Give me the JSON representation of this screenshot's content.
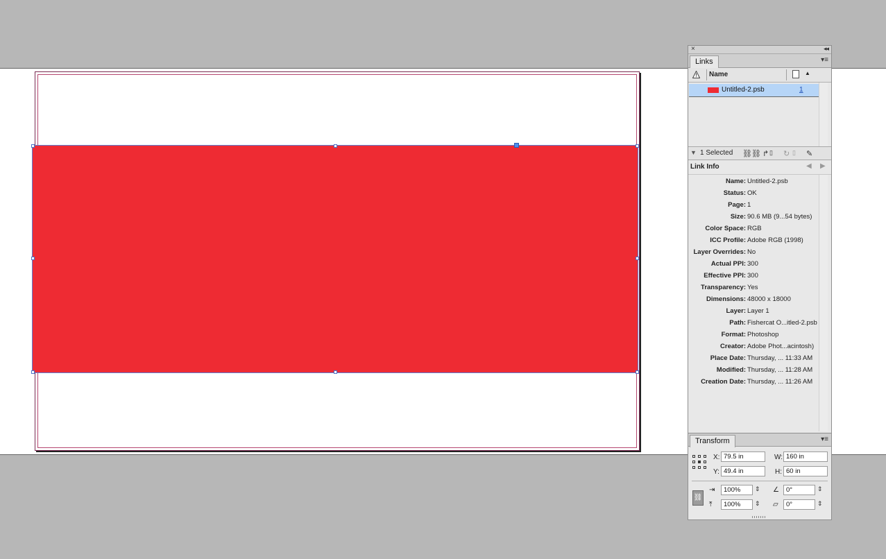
{
  "canvas": {
    "frame_color": "#ee2b33",
    "selection_color": "#4b72c8"
  },
  "links_panel": {
    "close_icon": "×",
    "collapse_icon": "◂◂",
    "tab": "Links",
    "menu_icon": "▾≡",
    "columns": {
      "name": "Name"
    },
    "rows": [
      {
        "name": "Untitled-2.psb",
        "page": "1",
        "swatch": "#ee2b33"
      }
    ],
    "footer": {
      "selected": "1 Selected"
    }
  },
  "link_info": {
    "title": "Link Info",
    "fields": [
      {
        "label": "Name:",
        "value": "Untitled-2.psb"
      },
      {
        "label": "Status:",
        "value": "OK"
      },
      {
        "label": "Page:",
        "value": "1"
      },
      {
        "label": "Size:",
        "value": "90.6 MB (9...54 bytes)"
      },
      {
        "label": "Color Space:",
        "value": "RGB"
      },
      {
        "label": "ICC Profile:",
        "value": "Adobe RGB (1998)"
      },
      {
        "label": "Layer Overrides:",
        "value": "No"
      },
      {
        "label": "Actual PPI:",
        "value": "300"
      },
      {
        "label": "Effective PPI:",
        "value": "300"
      },
      {
        "label": "Transparency:",
        "value": "Yes"
      },
      {
        "label": "Dimensions:",
        "value": "48000 x 18000"
      },
      {
        "label": "Layer:",
        "value": "Layer 1"
      },
      {
        "label": "Path:",
        "value": "Fishercat O...itled-2.psb"
      },
      {
        "label": "Format:",
        "value": "Photoshop"
      },
      {
        "label": "Creator:",
        "value": "Adobe Phot...acintosh)"
      },
      {
        "label": "Place Date:",
        "value": "Thursday, ... 11:33 AM"
      },
      {
        "label": "Modified:",
        "value": "Thursday, ... 11:28 AM"
      },
      {
        "label": "Creation Date:",
        "value": "Thursday, ... 11:26 AM"
      }
    ]
  },
  "transform_panel": {
    "tab": "Transform",
    "menu_icon": "▾≡",
    "x_label": "X:",
    "x_value": "79.5 in",
    "y_label": "Y:",
    "y_value": "49.4 in",
    "w_label": "W:",
    "w_value": "160 in",
    "h_label": "H:",
    "h_value": "60 in",
    "scale_x": "100%",
    "scale_y": "100%",
    "rotation": "0°",
    "shear": "0°"
  }
}
